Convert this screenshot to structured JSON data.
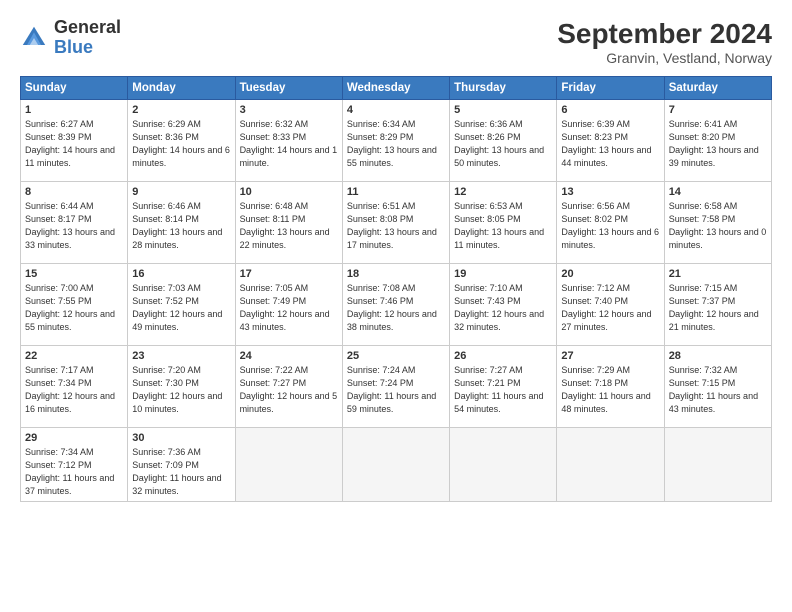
{
  "logo": {
    "general": "General",
    "blue": "Blue"
  },
  "title": "September 2024",
  "subtitle": "Granvin, Vestland, Norway",
  "headers": [
    "Sunday",
    "Monday",
    "Tuesday",
    "Wednesday",
    "Thursday",
    "Friday",
    "Saturday"
  ],
  "weeks": [
    [
      {
        "day": "1",
        "sunrise": "6:27 AM",
        "sunset": "8:39 PM",
        "daylight": "14 hours and 11 minutes."
      },
      {
        "day": "2",
        "sunrise": "6:29 AM",
        "sunset": "8:36 PM",
        "daylight": "14 hours and 6 minutes."
      },
      {
        "day": "3",
        "sunrise": "6:32 AM",
        "sunset": "8:33 PM",
        "daylight": "14 hours and 1 minute."
      },
      {
        "day": "4",
        "sunrise": "6:34 AM",
        "sunset": "8:29 PM",
        "daylight": "13 hours and 55 minutes."
      },
      {
        "day": "5",
        "sunrise": "6:36 AM",
        "sunset": "8:26 PM",
        "daylight": "13 hours and 50 minutes."
      },
      {
        "day": "6",
        "sunrise": "6:39 AM",
        "sunset": "8:23 PM",
        "daylight": "13 hours and 44 minutes."
      },
      {
        "day": "7",
        "sunrise": "6:41 AM",
        "sunset": "8:20 PM",
        "daylight": "13 hours and 39 minutes."
      }
    ],
    [
      {
        "day": "8",
        "sunrise": "6:44 AM",
        "sunset": "8:17 PM",
        "daylight": "13 hours and 33 minutes."
      },
      {
        "day": "9",
        "sunrise": "6:46 AM",
        "sunset": "8:14 PM",
        "daylight": "13 hours and 28 minutes."
      },
      {
        "day": "10",
        "sunrise": "6:48 AM",
        "sunset": "8:11 PM",
        "daylight": "13 hours and 22 minutes."
      },
      {
        "day": "11",
        "sunrise": "6:51 AM",
        "sunset": "8:08 PM",
        "daylight": "13 hours and 17 minutes."
      },
      {
        "day": "12",
        "sunrise": "6:53 AM",
        "sunset": "8:05 PM",
        "daylight": "13 hours and 11 minutes."
      },
      {
        "day": "13",
        "sunrise": "6:56 AM",
        "sunset": "8:02 PM",
        "daylight": "13 hours and 6 minutes."
      },
      {
        "day": "14",
        "sunrise": "6:58 AM",
        "sunset": "7:58 PM",
        "daylight": "13 hours and 0 minutes."
      }
    ],
    [
      {
        "day": "15",
        "sunrise": "7:00 AM",
        "sunset": "7:55 PM",
        "daylight": "12 hours and 55 minutes."
      },
      {
        "day": "16",
        "sunrise": "7:03 AM",
        "sunset": "7:52 PM",
        "daylight": "12 hours and 49 minutes."
      },
      {
        "day": "17",
        "sunrise": "7:05 AM",
        "sunset": "7:49 PM",
        "daylight": "12 hours and 43 minutes."
      },
      {
        "day": "18",
        "sunrise": "7:08 AM",
        "sunset": "7:46 PM",
        "daylight": "12 hours and 38 minutes."
      },
      {
        "day": "19",
        "sunrise": "7:10 AM",
        "sunset": "7:43 PM",
        "daylight": "12 hours and 32 minutes."
      },
      {
        "day": "20",
        "sunrise": "7:12 AM",
        "sunset": "7:40 PM",
        "daylight": "12 hours and 27 minutes."
      },
      {
        "day": "21",
        "sunrise": "7:15 AM",
        "sunset": "7:37 PM",
        "daylight": "12 hours and 21 minutes."
      }
    ],
    [
      {
        "day": "22",
        "sunrise": "7:17 AM",
        "sunset": "7:34 PM",
        "daylight": "12 hours and 16 minutes."
      },
      {
        "day": "23",
        "sunrise": "7:20 AM",
        "sunset": "7:30 PM",
        "daylight": "12 hours and 10 minutes."
      },
      {
        "day": "24",
        "sunrise": "7:22 AM",
        "sunset": "7:27 PM",
        "daylight": "12 hours and 5 minutes."
      },
      {
        "day": "25",
        "sunrise": "7:24 AM",
        "sunset": "7:24 PM",
        "daylight": "11 hours and 59 minutes."
      },
      {
        "day": "26",
        "sunrise": "7:27 AM",
        "sunset": "7:21 PM",
        "daylight": "11 hours and 54 minutes."
      },
      {
        "day": "27",
        "sunrise": "7:29 AM",
        "sunset": "7:18 PM",
        "daylight": "11 hours and 48 minutes."
      },
      {
        "day": "28",
        "sunrise": "7:32 AM",
        "sunset": "7:15 PM",
        "daylight": "11 hours and 43 minutes."
      }
    ],
    [
      {
        "day": "29",
        "sunrise": "7:34 AM",
        "sunset": "7:12 PM",
        "daylight": "11 hours and 37 minutes."
      },
      {
        "day": "30",
        "sunrise": "7:36 AM",
        "sunset": "7:09 PM",
        "daylight": "11 hours and 32 minutes."
      },
      null,
      null,
      null,
      null,
      null
    ]
  ]
}
